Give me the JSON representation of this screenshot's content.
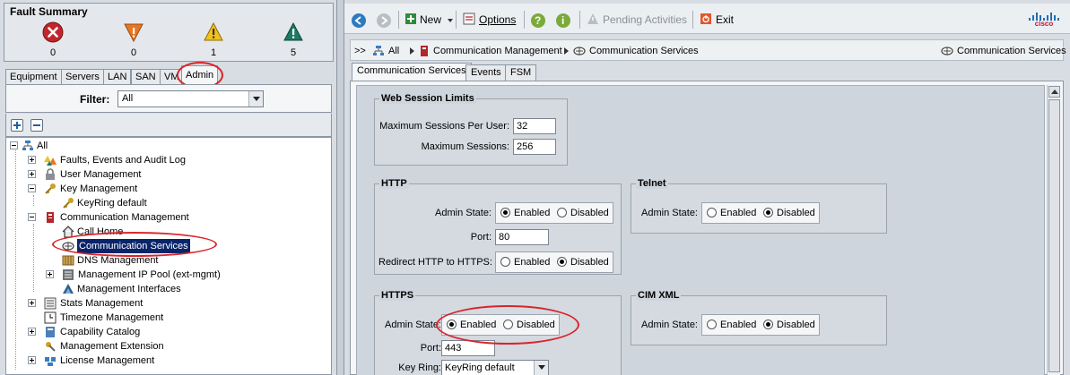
{
  "fault_summary": {
    "title": "Fault Summary",
    "items": [
      {
        "severity": "critical",
        "icon": "critical-x-icon",
        "color": "#c0272d",
        "count": "0"
      },
      {
        "severity": "major",
        "icon": "major-down-triangle-icon",
        "color": "#e87722",
        "count": "0"
      },
      {
        "severity": "minor",
        "icon": "minor-triangle-icon",
        "color": "#f2c21b",
        "count": "1"
      },
      {
        "severity": "warning",
        "icon": "warning-triangle-icon",
        "color": "#1d7a63",
        "count": "5"
      }
    ]
  },
  "left_tabs": [
    "Equipment",
    "Servers",
    "LAN",
    "SAN",
    "VM",
    "Admin"
  ],
  "left_active_tab": "Admin",
  "filter": {
    "label": "Filter:",
    "value": "All"
  },
  "tree": {
    "root": "All",
    "items": [
      {
        "label": "Faults, Events and Audit Log",
        "icon": "faults-icon"
      },
      {
        "label": "User Management",
        "icon": "lock-icon"
      },
      {
        "label": "Key Management",
        "icon": "key-icon"
      },
      {
        "label": "KeyRing default",
        "icon": "key-icon"
      },
      {
        "label": "Communication Management",
        "icon": "comm-mgmt-icon"
      },
      {
        "label": "Call Home",
        "icon": "call-home-icon"
      },
      {
        "label": "Communication Services",
        "icon": "comm-services-icon"
      },
      {
        "label": "DNS Management",
        "icon": "dns-icon"
      },
      {
        "label": "Management IP Pool (ext-mgmt)",
        "icon": "ip-pool-icon"
      },
      {
        "label": "Management Interfaces",
        "icon": "mgmt-interface-icon"
      },
      {
        "label": "Stats Management",
        "icon": "stats-icon"
      },
      {
        "label": "Timezone Management",
        "icon": "clock-icon"
      },
      {
        "label": "Capability Catalog",
        "icon": "catalog-icon"
      },
      {
        "label": "Management Extension",
        "icon": "extension-icon"
      },
      {
        "label": "License Management",
        "icon": "license-icon"
      }
    ]
  },
  "toolbar": {
    "new": "New",
    "options": "Options",
    "pending": "Pending Activities",
    "exit": "Exit",
    "brand": "cisco"
  },
  "breadcrumb": {
    "prefix": ">>",
    "items": [
      "All",
      "Communication Management",
      "Communication Services"
    ],
    "right": "Communication Services"
  },
  "right_tabs": [
    "Communication Services",
    "Events",
    "FSM"
  ],
  "right_active_tab": "Communication Services",
  "web_session": {
    "title": "Web Session Limits",
    "max_per_user_label": "Maximum Sessions Per User:",
    "max_per_user_value": "32",
    "max_sessions_label": "Maximum Sessions:",
    "max_sessions_value": "256"
  },
  "http": {
    "title": "HTTP",
    "admin_state_label": "Admin State:",
    "enabled": "Enabled",
    "disabled": "Disabled",
    "port_label": "Port:",
    "port_value": "80",
    "redirect_label": "Redirect HTTP to HTTPS:",
    "redirect_enabled": "Enabled",
    "redirect_disabled": "Disabled"
  },
  "telnet": {
    "title": "Telnet",
    "admin_state_label": "Admin State:",
    "enabled": "Enabled",
    "disabled": "Disabled"
  },
  "https": {
    "title": "HTTPS",
    "admin_state_label": "Admin State:",
    "enabled": "Enabled",
    "disabled": "Disabled",
    "port_label": "Port:",
    "port_value": "443",
    "keyring_label": "Key Ring:",
    "keyring_value": "KeyRing default"
  },
  "cimxml": {
    "title": "CIM XML",
    "admin_state_label": "Admin State:",
    "enabled": "Enabled",
    "disabled": "Disabled"
  },
  "colors": {
    "annotation": "#d9252b",
    "selection": "#0a246a"
  }
}
